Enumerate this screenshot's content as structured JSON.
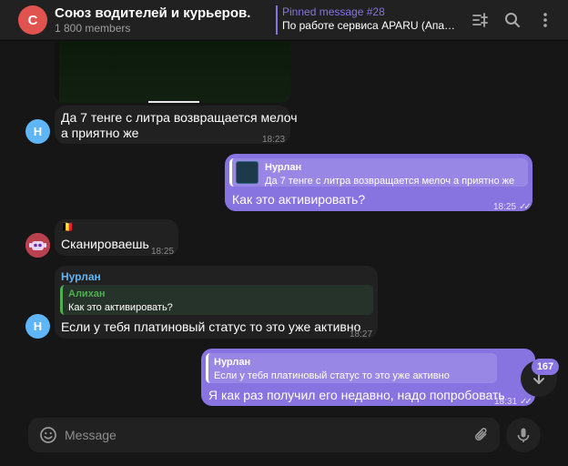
{
  "header": {
    "avatar_letter": "С",
    "title": "Союз водителей и курьеров.",
    "members": "1 800 members",
    "pinned_title": "Pinned message #28",
    "pinned_text": "По работе сервиса APARU (АпаруТ..."
  },
  "messages": {
    "m1": {
      "avatar_letter": "Н",
      "text_line1": "Да 7 тенге с литра возвращается мелоч",
      "text_line2": "а приятно же",
      "time": "18:23"
    },
    "m2": {
      "reply_name": "Нурлан",
      "reply_text": "Да 7 тенге с литра возвращается мелоч а приятно же",
      "text": "Как это активировать?",
      "time": "18:25"
    },
    "m3": {
      "flag": "🇧🇪",
      "text": "Сканироваешь",
      "time": "18:25"
    },
    "m4": {
      "sender": "Нурлан",
      "reply_name": "Алихан",
      "reply_text": "Как это активировать?",
      "avatar_letter": "Н",
      "text": "Если у тебя платиновый статус то это уже активно",
      "time": "18:27"
    },
    "m5": {
      "reply_name": "Нурлан",
      "reply_text": "Если у тебя платиновый статус то это уже активно",
      "text": "Я как раз получил его недавно, надо попробовать",
      "time": "18:31"
    }
  },
  "composer": {
    "placeholder": "Message"
  },
  "unread_count": "167",
  "colors": {
    "accent": "#8774e1",
    "reply_green": "#4fae4e",
    "sender_blue": "#5eb5f7",
    "chat_avatar": "#e1534f"
  }
}
